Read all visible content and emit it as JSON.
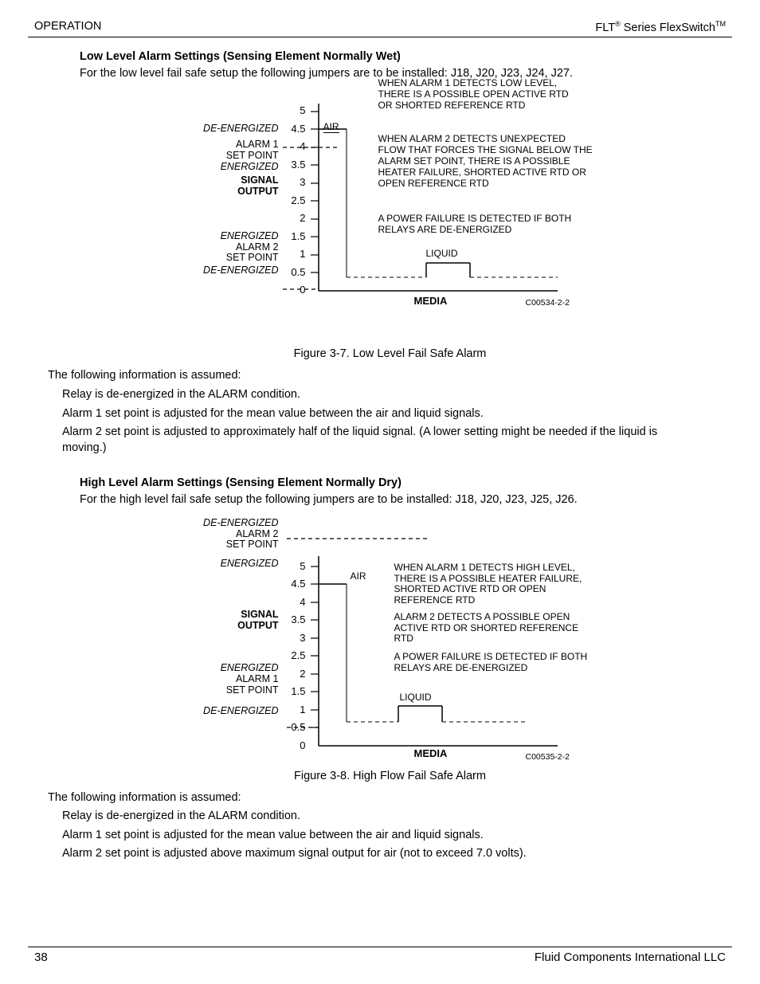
{
  "header": {
    "left": "OPERATION",
    "right_prefix": "FLT",
    "right_suffix": " Series FlexSwitch",
    "reg": "®",
    "tm": "TM"
  },
  "section1": {
    "title": "Low Level Alarm Settings  (Sensing Element Normally Wet)",
    "intro": "For the low level fail safe setup the following jumpers are to be installed:  J18, J20, J23, J24, J27.",
    "caption": "Figure 3-7.  Low Level Fail Safe Alarm",
    "assumed_title": "The following information is assumed:",
    "assumed": [
      "Relay is de-energized in the ALARM condition.",
      "Alarm 1 set point  is adjusted for the mean value between the air and liquid signals.",
      "Alarm 2 set point  is adjusted to approximately half of the liquid signal.  (A lower setting might be needed if the liquid is moving.)"
    ]
  },
  "section2": {
    "title": "High Level Alarm Settings  (Sensing Element Normally Dry)",
    "intro": "For the high level fail safe setup the following jumpers are to be installed:  J18, J20, J23, J25, J26.",
    "caption": "Figure 3-8.  High Flow Fail Safe Alarm",
    "assumed_title": "The following information is assumed:",
    "assumed": [
      "Relay is de-energized in the ALARM condition.",
      "Alarm 1 set point  is adjusted for the mean value between the air and liquid signals.",
      "Alarm 2 set point  is adjusted above maximum signal output for air  (not to exceed 7.0 volts)."
    ]
  },
  "chart_data": [
    {
      "type": "line",
      "title": "Low Level Fail Safe Alarm",
      "xlabel": "MEDIA",
      "ylabel": "SIGNAL OUTPUT",
      "ylim": [
        0,
        5.0
      ],
      "yticks": [
        0,
        0.5,
        1.0,
        1.5,
        2.0,
        2.5,
        3.0,
        3.5,
        4.0,
        4.5,
        5.0
      ],
      "left_labels": {
        "de_energized_top": "DE-ENERGIZED",
        "alarm1": [
          "ALARM 1",
          "SET POINT"
        ],
        "energized_mid": "ENERGIZED",
        "signal_output": [
          "SIGNAL",
          "OUTPUT"
        ],
        "energized_low": "ENERGIZED",
        "alarm2": [
          "ALARM 2",
          "SET POINT"
        ],
        "de_energized_bottom": "DE-ENERGIZED"
      },
      "annotations": {
        "air": "AIR",
        "liquid": "LIQUID",
        "note1": "WHEN ALARM 1 DETECTS LOW LEVEL, THERE IS A POSSIBLE OPEN ACTIVE RTD OR SHORTED REFERENCE RTD",
        "note2": "WHEN ALARM 2 DETECTS UNEXPECTED FLOW THAT FORCES THE SIGNAL BELOW THE ALARM SET POINT, THERE IS A POSSIBLE HEATER FAILURE, SHORTED ACTIVE RTD OR OPEN REFERENCE RTD",
        "note3": "A POWER FAILURE IS DETECTED IF BOTH RELAYS ARE DE-ENERGIZED"
      },
      "set_points": {
        "alarm1": 4.0,
        "alarm2": 0.0
      },
      "series": [
        {
          "name": "AIR",
          "y": 4.5,
          "xrange": [
            0,
            0.12
          ]
        },
        {
          "name": "LIQUID",
          "y": 0.8,
          "xrange": [
            0.45,
            0.65
          ]
        }
      ],
      "code": "C00534-2-2"
    },
    {
      "type": "line",
      "title": "High Flow Fail Safe Alarm",
      "xlabel": "MEDIA",
      "ylabel": "SIGNAL OUTPUT",
      "ylim": [
        0,
        5.0
      ],
      "yticks": [
        0,
        0.5,
        1.0,
        1.5,
        2.0,
        2.5,
        3.0,
        3.5,
        4.0,
        4.5,
        5.0
      ],
      "left_labels": {
        "de_energized_top": "DE-ENERGIZED",
        "alarm2": [
          "ALARM 2",
          "SET POINT"
        ],
        "energized_top": "ENERGIZED",
        "signal_output": [
          "SIGNAL",
          "OUTPUT"
        ],
        "energized_low": "ENERGIZED",
        "alarm1": [
          "ALARM 1",
          "SET POINT"
        ],
        "de_energized_bottom": "DE-ENERGIZED"
      },
      "annotations": {
        "air": "AIR",
        "liquid": "LIQUID",
        "note1": "WHEN ALARM 1 DETECTS HIGH LEVEL, THERE  IS A POSSIBLE HEATER FAILURE, SHORTED ACTIVE RTD OR OPEN REFERENCE RTD",
        "note2": "ALARM 2 DETECTS A POSSIBLE OPEN ACTIVE RTD OR SHORTED REFERENCE RTD",
        "note3": "A POWER FAILURE IS DETECTED IF BOTH RELAYS ARE DE-ENERGIZED"
      },
      "set_points": {
        "alarm1": 0.5,
        "alarm2_above_max": true
      },
      "series": [
        {
          "name": "AIR",
          "y": 4.5,
          "xrange": [
            0,
            0.12
          ]
        },
        {
          "name": "LIQUID",
          "y": 1.0,
          "xrange": [
            0.38,
            0.55
          ]
        }
      ],
      "code": "C00535-2-2"
    }
  ],
  "footer": {
    "page": "38",
    "company": "Fluid Components International LLC"
  }
}
